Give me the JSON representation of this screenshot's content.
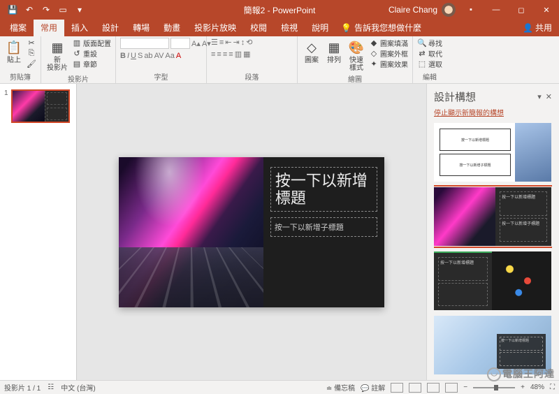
{
  "titlebar": {
    "doc_title": "簡報2 - PowerPoint",
    "user_name": "Claire Chang"
  },
  "tabs": {
    "file": "檔案",
    "home": "常用",
    "insert": "插入",
    "design": "設計",
    "transitions": "轉場",
    "animations": "動畫",
    "slideshow": "投影片放映",
    "review": "校閱",
    "view": "檢視",
    "help": "說明",
    "tell_me": "告訴我您想做什麼",
    "share": "共用"
  },
  "ribbon": {
    "clipboard": {
      "paste": "貼上",
      "label": "剪貼簿"
    },
    "slides": {
      "new_slide": "新\n投影片",
      "layout": "版面配置",
      "reset": "重設",
      "section": "章節",
      "label": "投影片"
    },
    "font": {
      "label": "字型"
    },
    "paragraph": {
      "label": "段落"
    },
    "drawing": {
      "shapes": "圖案",
      "arrange": "排列",
      "quick": "快速\n樣式",
      "fill": "圖案填滿",
      "outline": "圖案外框",
      "effects": "圖案效果",
      "label": "繪圖"
    },
    "editing": {
      "find": "尋找",
      "replace": "取代",
      "select": "選取",
      "label": "編輯"
    }
  },
  "slide": {
    "title_placeholder": "按一下以新增標題",
    "subtitle_placeholder": "按一下以新增子標題"
  },
  "design_pane": {
    "title": "設計構想",
    "stop_link": "停止顯示新簡報的構想",
    "idea_title": "按一下以新增標題",
    "idea_sub": "按一下以新增子標題"
  },
  "status": {
    "slide_counter": "投影片 1 / 1",
    "language": "中文 (台灣)",
    "notes": "備忘稿",
    "comments": "註解",
    "zoom": "48%"
  },
  "thumb": {
    "num": "1"
  },
  "watermark": "電腦王阿達"
}
